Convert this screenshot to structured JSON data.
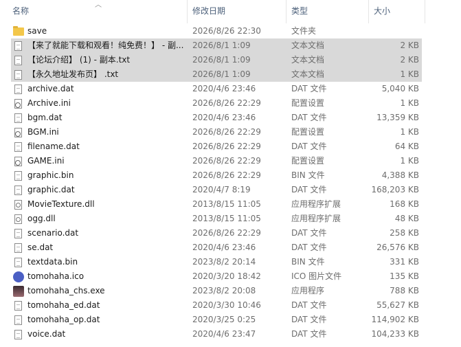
{
  "columns": {
    "name": "名称",
    "date": "修改日期",
    "type": "类型",
    "size": "大小"
  },
  "files": [
    {
      "name": "save",
      "date": "2026/8/26 22:30",
      "type": "文件夹",
      "size": "",
      "icon": "folder-icon",
      "selected": false
    },
    {
      "name": "【来了就能下载和观看！纯免费！】 - 副...",
      "date": "2026/8/1 1:09",
      "type": "文本文档",
      "size": "2 KB",
      "icon": "text-file-icon",
      "selected": true
    },
    {
      "name": "【论坛介绍】 (1) - 副本.txt",
      "date": "2026/8/1 1:09",
      "type": "文本文档",
      "size": "2 KB",
      "icon": "text-file-icon",
      "selected": true
    },
    {
      "name": "【永久地址发布页】 .txt",
      "date": "2026/8/1 1:09",
      "type": "文本文档",
      "size": "1 KB",
      "icon": "text-file-icon",
      "selected": true
    },
    {
      "name": "archive.dat",
      "date": "2020/4/6 23:46",
      "type": "DAT 文件",
      "size": "5,040 KB",
      "icon": "file-icon",
      "selected": false
    },
    {
      "name": "Archive.ini",
      "date": "2026/8/26 22:29",
      "type": "配置设置",
      "size": "1 KB",
      "icon": "settings-file-icon",
      "selected": false
    },
    {
      "name": "bgm.dat",
      "date": "2020/4/6 23:46",
      "type": "DAT 文件",
      "size": "13,359 KB",
      "icon": "file-icon",
      "selected": false
    },
    {
      "name": "BGM.ini",
      "date": "2026/8/26 22:29",
      "type": "配置设置",
      "size": "1 KB",
      "icon": "settings-file-icon",
      "selected": false
    },
    {
      "name": "filename.dat",
      "date": "2026/8/26 22:29",
      "type": "DAT 文件",
      "size": "64 KB",
      "icon": "file-icon",
      "selected": false
    },
    {
      "name": "GAME.ini",
      "date": "2026/8/26 22:29",
      "type": "配置设置",
      "size": "1 KB",
      "icon": "settings-file-icon",
      "selected": false
    },
    {
      "name": "graphic.bin",
      "date": "2026/8/26 22:29",
      "type": "BIN 文件",
      "size": "4,388 KB",
      "icon": "file-icon",
      "selected": false
    },
    {
      "name": "graphic.dat",
      "date": "2020/4/7 8:19",
      "type": "DAT 文件",
      "size": "168,203 KB",
      "icon": "file-icon",
      "selected": false
    },
    {
      "name": "MovieTexture.dll",
      "date": "2013/8/15 11:05",
      "type": "应用程序扩展",
      "size": "168 KB",
      "icon": "dll-file-icon",
      "selected": false
    },
    {
      "name": "ogg.dll",
      "date": "2013/8/15 11:05",
      "type": "应用程序扩展",
      "size": "48 KB",
      "icon": "dll-file-icon",
      "selected": false
    },
    {
      "name": "scenario.dat",
      "date": "2026/8/26 22:29",
      "type": "DAT 文件",
      "size": "258 KB",
      "icon": "file-icon",
      "selected": false
    },
    {
      "name": "se.dat",
      "date": "2020/4/6 23:46",
      "type": "DAT 文件",
      "size": "26,576 KB",
      "icon": "file-icon",
      "selected": false
    },
    {
      "name": "textdata.bin",
      "date": "2023/8/2 20:14",
      "type": "BIN 文件",
      "size": "331 KB",
      "icon": "file-icon",
      "selected": false
    },
    {
      "name": "tomohaha.ico",
      "date": "2020/3/20 18:42",
      "type": "ICO 图片文件",
      "size": "135 KB",
      "icon": "ico-image-icon",
      "selected": false
    },
    {
      "name": "tomohaha_chs.exe",
      "date": "2023/8/2 20:08",
      "type": "应用程序",
      "size": "788 KB",
      "icon": "exe-app-icon",
      "selected": false
    },
    {
      "name": "tomohaha_ed.dat",
      "date": "2020/3/30 10:46",
      "type": "DAT 文件",
      "size": "55,627 KB",
      "icon": "file-icon",
      "selected": false
    },
    {
      "name": "tomohaha_op.dat",
      "date": "2020/3/25 0:25",
      "type": "DAT 文件",
      "size": "114,902 KB",
      "icon": "file-icon",
      "selected": false
    },
    {
      "name": "voice.dat",
      "date": "2020/4/6 23:47",
      "type": "DAT 文件",
      "size": "104,233 KB",
      "icon": "file-icon",
      "selected": false
    }
  ]
}
